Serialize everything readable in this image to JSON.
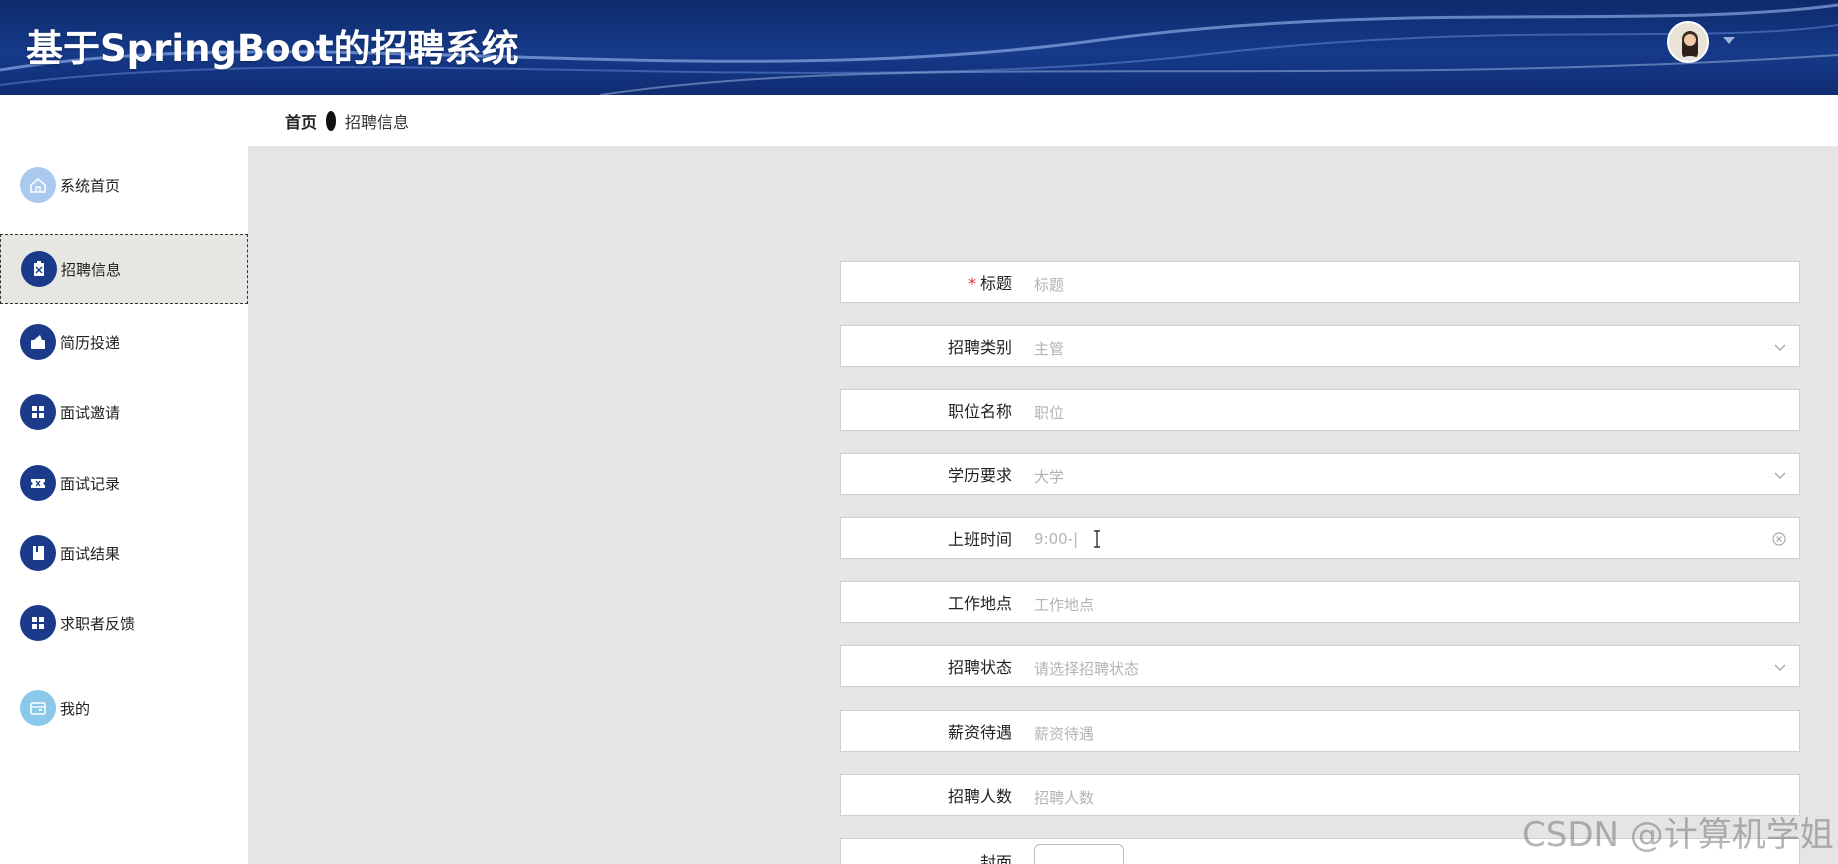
{
  "header": {
    "title": "基于SpringBoot的招聘系统"
  },
  "breadcrumb": {
    "home": "首页",
    "current": "招聘信息"
  },
  "sidebar": {
    "items": [
      {
        "label": "系统首页",
        "icon": "home-icon"
      },
      {
        "label": "招聘信息",
        "icon": "clipboard-icon",
        "active": true
      },
      {
        "label": "简历投递",
        "icon": "wallet-icon"
      },
      {
        "label": "面试邀请",
        "icon": "grid-icon"
      },
      {
        "label": "面试记录",
        "icon": "ticket-icon"
      },
      {
        "label": "面试结果",
        "icon": "book-icon"
      },
      {
        "label": "求职者反馈",
        "icon": "grid-icon"
      },
      {
        "label": "我的",
        "icon": "card-icon"
      }
    ]
  },
  "form": {
    "title": {
      "label": "标题",
      "placeholder": "标题",
      "required": true
    },
    "category": {
      "label": "招聘类别",
      "value": "主管"
    },
    "position": {
      "label": "职位名称",
      "placeholder": "职位"
    },
    "education": {
      "label": "学历要求",
      "value": "大学"
    },
    "worktime": {
      "label": "上班时间",
      "value": "9:00-|"
    },
    "location": {
      "label": "工作地点",
      "placeholder": "工作地点"
    },
    "status": {
      "label": "招聘状态",
      "placeholder": "请选择招聘状态"
    },
    "salary": {
      "label": "薪资待遇",
      "placeholder": "薪资待遇"
    },
    "headcount": {
      "label": "招聘人数",
      "placeholder": "招聘人数"
    },
    "cover": {
      "label": "封面"
    }
  },
  "watermark": "CSDN @计算机学姐",
  "colors": {
    "header": "#163a8a",
    "nav_icon_dark": "#1b3a8a",
    "nav_icon_light": "#a9c9ef",
    "main_bg": "#e5e5e5",
    "required": "#e33333"
  }
}
